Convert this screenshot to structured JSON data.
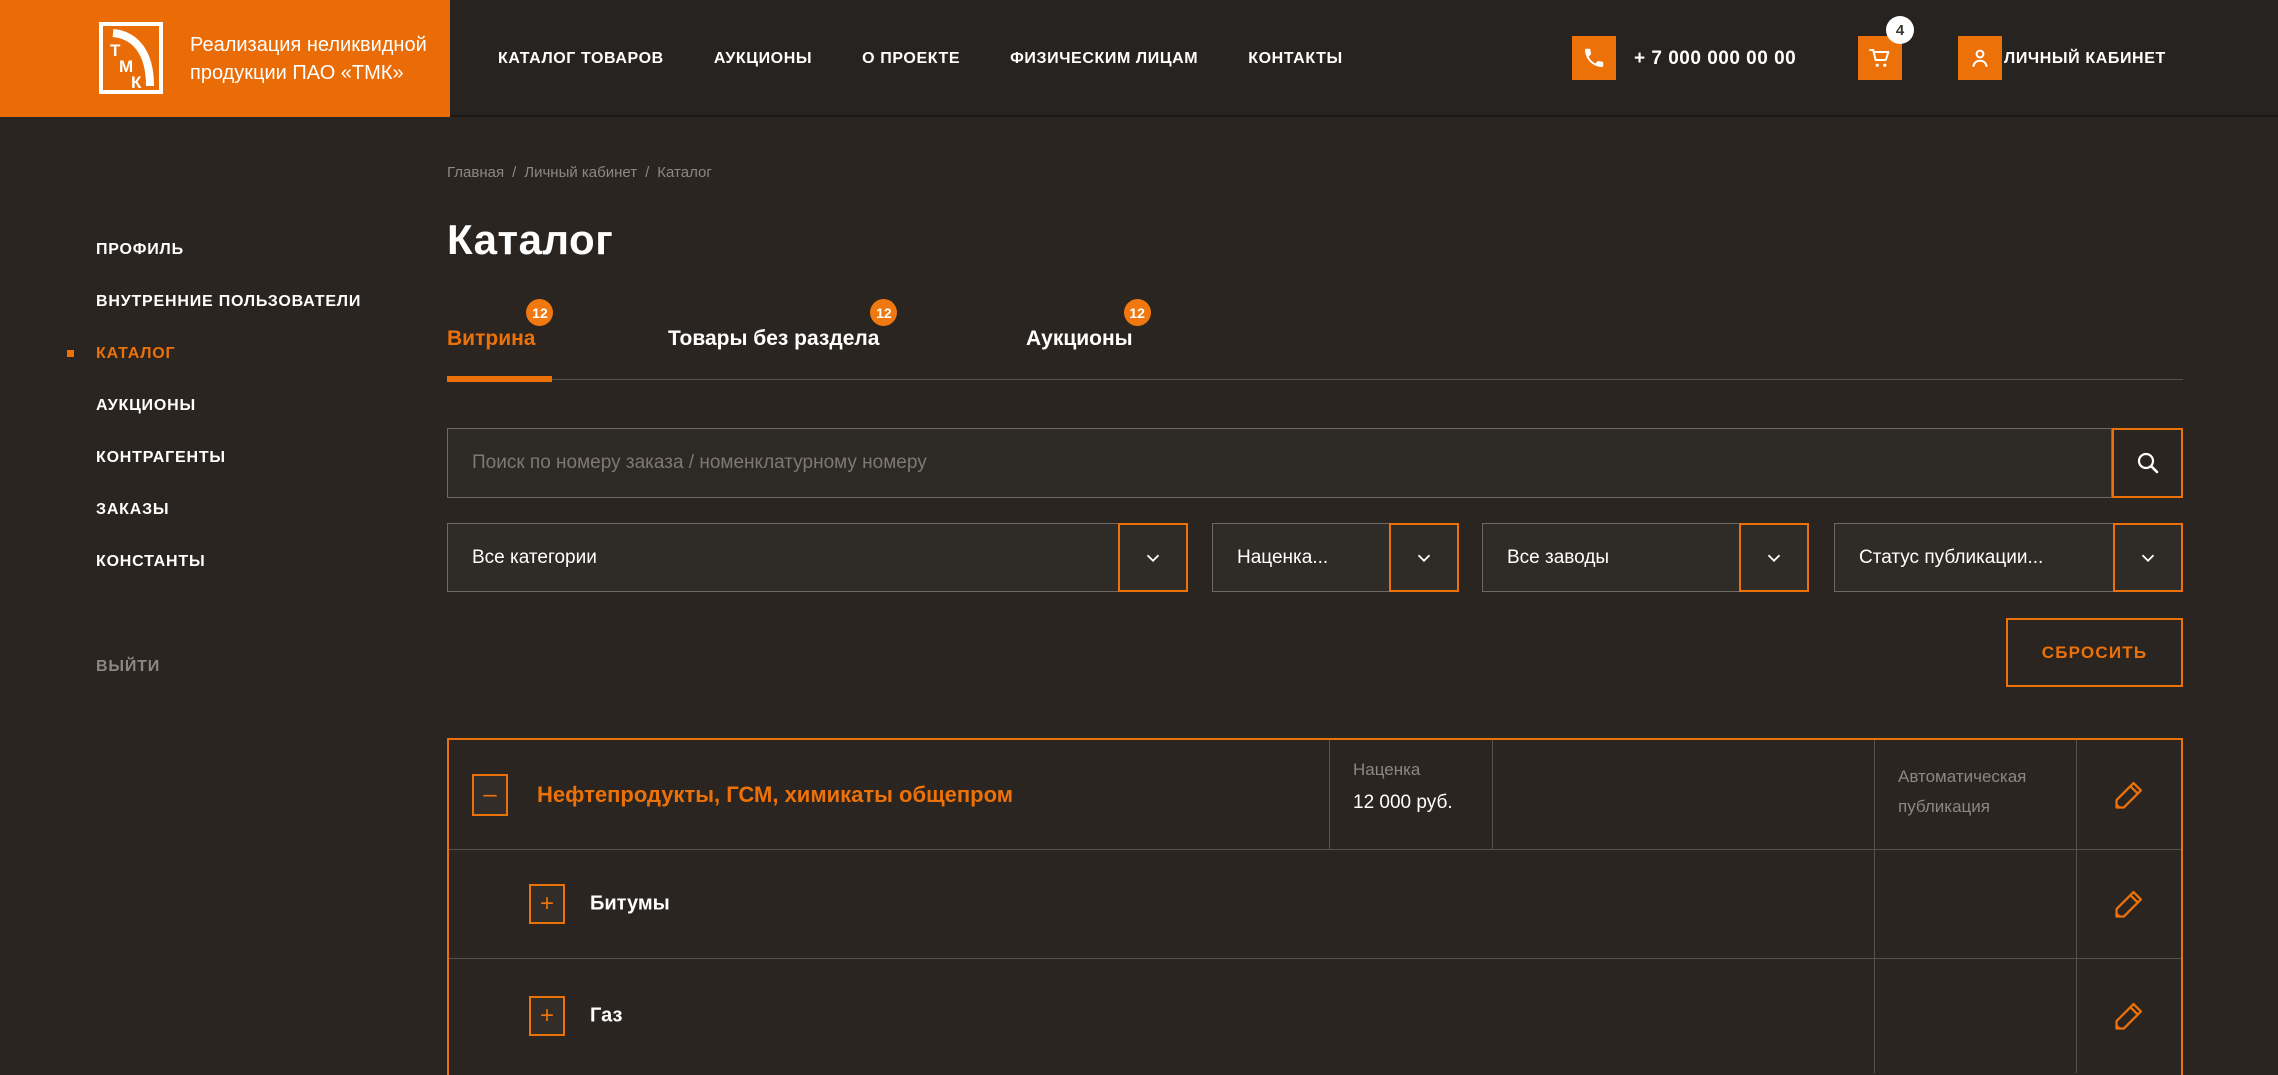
{
  "colors": {
    "accent": "#ED7109",
    "logo_block": "#EA6C06",
    "badge": "#F0780F",
    "page_background": "#2A2521",
    "muted_text": "#8D8781"
  },
  "header": {
    "brand": {
      "logo_letters": "ТМК",
      "tagline_line1": "Реализация неликвидной",
      "tagline_line2": "продукции ПАО «ТМК»"
    },
    "nav": [
      {
        "label": "КАТАЛОГ ТОВАРОВ"
      },
      {
        "label": "АУКЦИОНЫ"
      },
      {
        "label": "О ПРОЕКТЕ"
      },
      {
        "label": "ФИЗИЧЕСКИМ ЛИЦАМ"
      },
      {
        "label": "КОНТАКТЫ"
      }
    ],
    "phone_number": "+ 7 000 000 00 00",
    "cart_badge_count": "4",
    "account_label": "ЛИЧНЫЙ КАБИНЕТ"
  },
  "sidebar": {
    "items": [
      {
        "label": "ПРОФИЛЬ",
        "active": false
      },
      {
        "label": "ВНУТРЕННИЕ ПОЛЬЗОВАТЕЛИ",
        "active": false
      },
      {
        "label": "КАТАЛОГ",
        "active": true
      },
      {
        "label": "АУКЦИОНЫ",
        "active": false
      },
      {
        "label": "КОНТРАГЕНТЫ",
        "active": false
      },
      {
        "label": "ЗАКАЗЫ",
        "active": false
      },
      {
        "label": "КОНСТАНТЫ",
        "active": false
      }
    ],
    "logout_label": "ВЫЙТИ"
  },
  "breadcrumb": {
    "items": [
      "Главная",
      "Личный кабинет",
      "Каталог"
    ],
    "separator": "/"
  },
  "page": {
    "title": "Каталог"
  },
  "tabs": [
    {
      "label": "Витрина",
      "badge": "12",
      "active": true
    },
    {
      "label": "Товары без раздела",
      "badge": "12",
      "active": false
    },
    {
      "label": "Аукционы",
      "badge": "12",
      "active": false
    }
  ],
  "search": {
    "placeholder": "Поиск по номеру заказа / номенклатурному номеру"
  },
  "filters": [
    {
      "value": "Все категории"
    },
    {
      "value": "Наценка..."
    },
    {
      "value": "Все заводы"
    },
    {
      "value": "Статус публикации..."
    }
  ],
  "actions": {
    "reset_label": "СБРОСИТЬ"
  },
  "catalog": {
    "root_row": {
      "title": "Нефтепродукты, ГСМ, химикаты общепром",
      "markup_label": "Наценка",
      "markup_value": "12 000 руб.",
      "publication_label": "Автоматическая публикация",
      "toggle": "–"
    },
    "child_rows": [
      {
        "title": "Битумы",
        "toggle": "+"
      },
      {
        "title": "Газ",
        "toggle": "+"
      }
    ]
  }
}
